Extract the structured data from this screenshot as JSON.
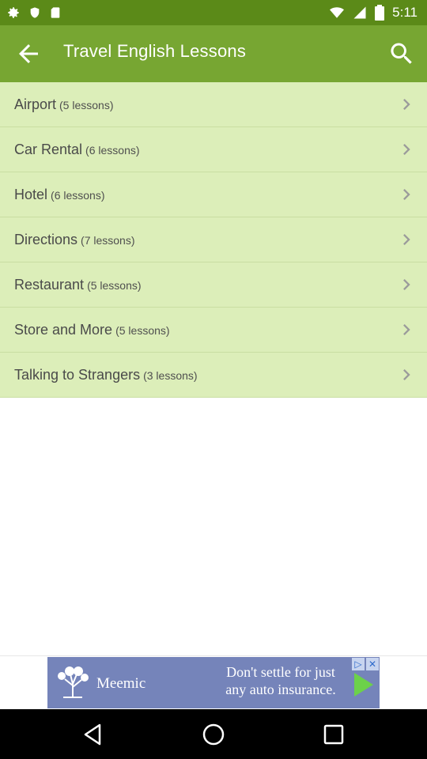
{
  "status_bar": {
    "time": "5:11"
  },
  "app_bar": {
    "title": "Travel English Lessons"
  },
  "lessons": [
    {
      "name": "Airport",
      "count": "(5 lessons)"
    },
    {
      "name": "Car Rental",
      "count": "(6 lessons)"
    },
    {
      "name": "Hotel",
      "count": "(6 lessons)"
    },
    {
      "name": "Directions",
      "count": "(7 lessons)"
    },
    {
      "name": "Restaurant",
      "count": "(5 lessons)"
    },
    {
      "name": "Store and More",
      "count": "(5 lessons)"
    },
    {
      "name": "Talking to Strangers",
      "count": "(3 lessons)"
    }
  ],
  "ad": {
    "brand": "Meemic",
    "line1": "Don't settle for just",
    "line2": "any auto insurance."
  },
  "colors": {
    "status_bar": "#5b8a18",
    "app_bar": "#77a632",
    "list_item": "#dceeb9",
    "ad_bg": "#7584ba"
  }
}
